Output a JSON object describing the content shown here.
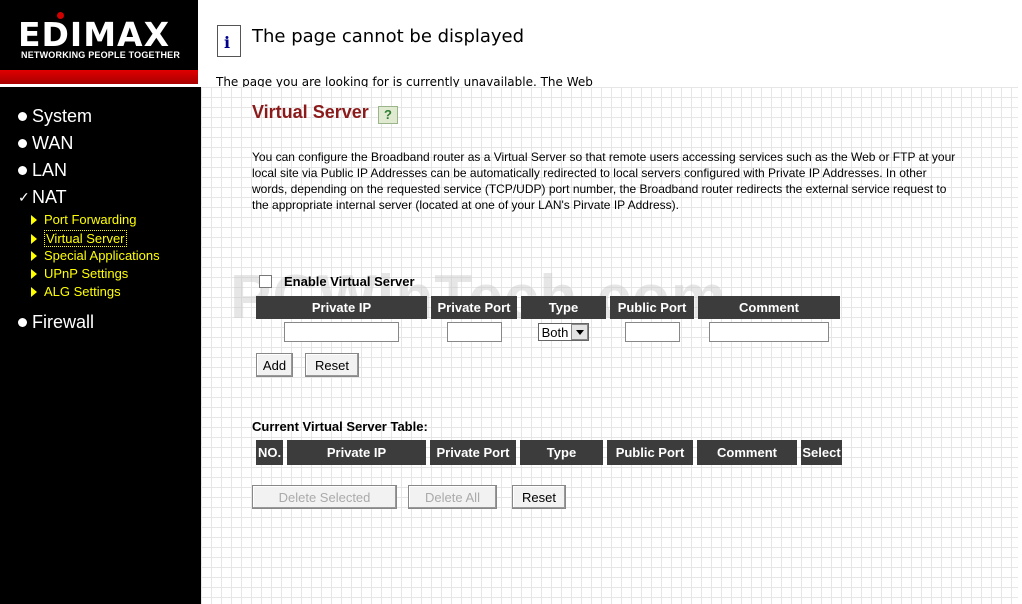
{
  "brand": {
    "logo": "EDIMAX",
    "tagline": "NETWORKING PEOPLE TOGETHER"
  },
  "error": {
    "title": "The page cannot be displayed",
    "subtitle": "The page you are looking for is currently unavailable. The Web"
  },
  "menu": {
    "main": [
      {
        "label": "System",
        "marker": "bullet"
      },
      {
        "label": "WAN",
        "marker": "bullet"
      },
      {
        "label": "LAN",
        "marker": "bullet"
      },
      {
        "label": "NAT",
        "marker": "check"
      },
      {
        "label": "Firewall",
        "marker": "bullet"
      }
    ],
    "nat_sub": [
      {
        "label": "Port Forwarding"
      },
      {
        "label": "Virtual Server",
        "active": true
      },
      {
        "label": "Special Applications"
      },
      {
        "label": "UPnP Settings"
      },
      {
        "label": "ALG Settings"
      }
    ]
  },
  "page": {
    "title": "Virtual Server",
    "description": "You can configure the Broadband router as a Virtual Server so that remote users accessing services such as the Web or FTP at your local site via Public IP Addresses can be automatically redirected to local servers configured with Private IP Addresses. In other words, depending on the requested service (TCP/UDP) port number, the Broadband router redirects the external service request to the appropriate internal server (located at one of your LAN's Pirvate IP Address).",
    "enable_label": "Enable Virtual Server",
    "enable_checked": false,
    "add_headers": [
      "Private IP",
      "Private Port",
      "Type",
      "Public Port",
      "Comment"
    ],
    "type_value": "Both",
    "add_button": "Add",
    "reset_button": "Reset",
    "table_label": "Current Virtual Server Table:",
    "table_headers": [
      "NO.",
      "Private IP",
      "Private Port",
      "Type",
      "Public Port",
      "Comment",
      "Select"
    ],
    "delete_selected": "Delete Selected",
    "delete_all": "Delete All",
    "reset_button_2": "Reset"
  },
  "watermark": "PCWinTech.com",
  "colors": {
    "title": "#8b1a1a",
    "submenu": "#ffff00",
    "header_bg": "#3c3c3c",
    "logo_red": "#d00000"
  }
}
